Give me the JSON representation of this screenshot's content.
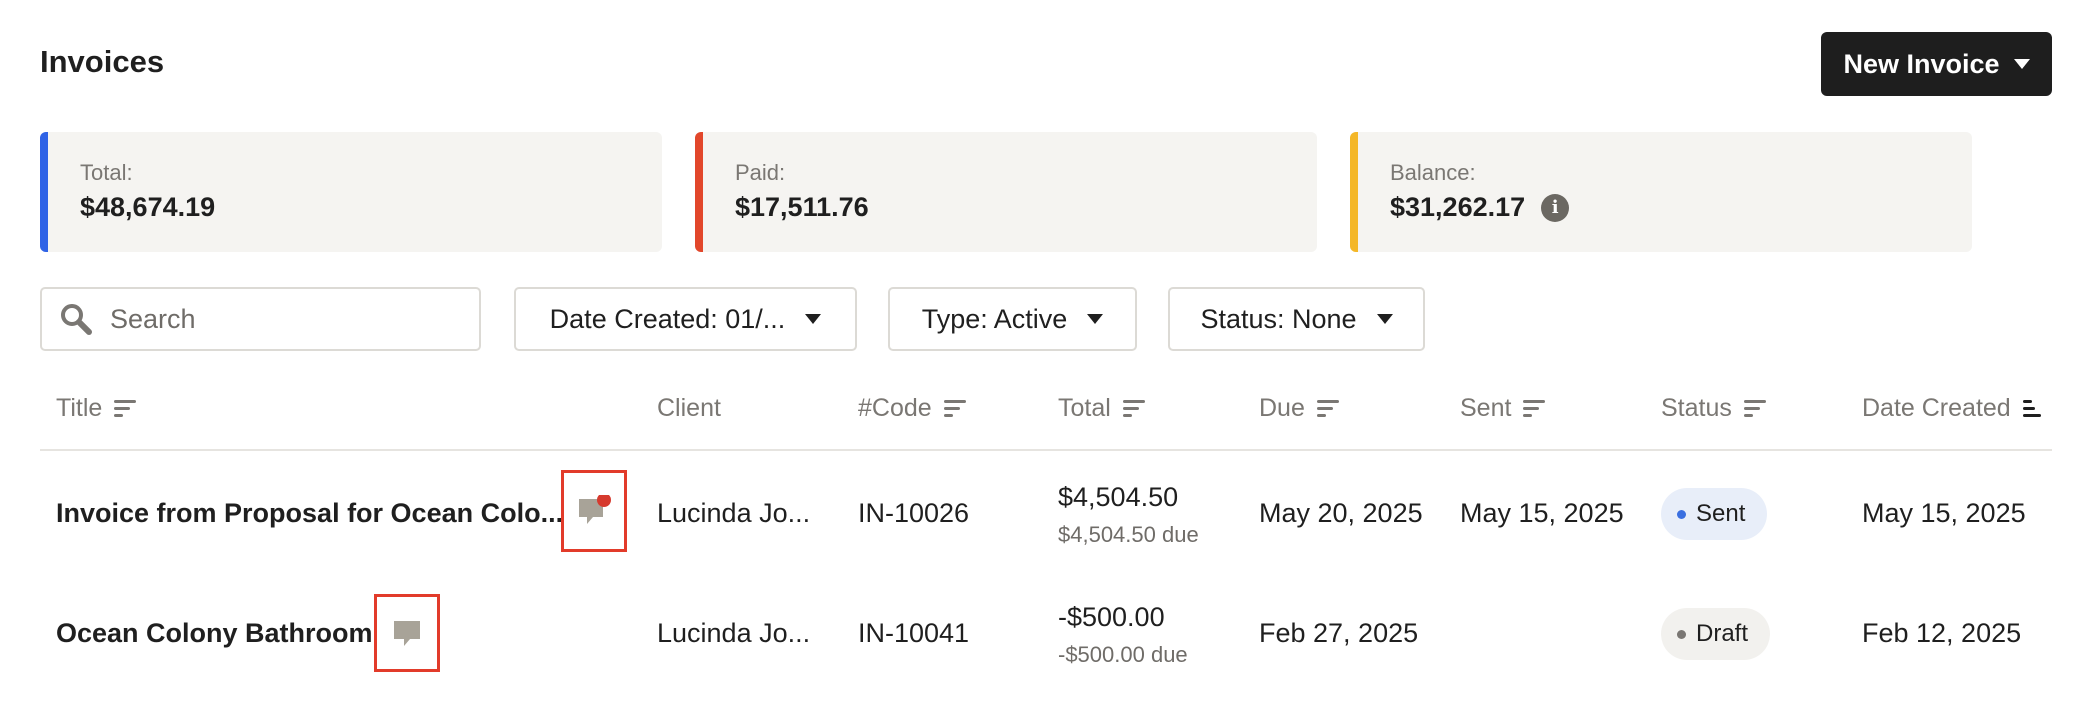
{
  "page": {
    "title": "Invoices"
  },
  "new_invoice": {
    "label": "New Invoice"
  },
  "stats": [
    {
      "label": "Total:",
      "value": "$48,674.19",
      "color": "#2f63e6"
    },
    {
      "label": "Paid:",
      "value": "$17,511.76",
      "color": "#e2472b"
    },
    {
      "label": "Balance:",
      "value": "$31,262.17",
      "color": "#f4b728"
    }
  ],
  "search": {
    "placeholder": "Search",
    "value": ""
  },
  "filters": [
    {
      "label": "Date Created: 01/..."
    },
    {
      "label": "Type: Active"
    },
    {
      "label": "Status: None"
    }
  ],
  "table": {
    "columns": [
      "Title",
      "Client",
      "#Code",
      "Total",
      "Due",
      "Sent",
      "Status",
      "Date Created"
    ],
    "rows": [
      {
        "title": "Invoice from Proposal for Ocean Colo...",
        "client": "Lucinda Jo...",
        "code": "IN-10026",
        "total": "$4,504.50",
        "due_amount": "$4,504.50 due",
        "due": "May 20, 2025",
        "sent": "May 15, 2025",
        "status": "Sent",
        "status_color": "#3a6fe0",
        "status_bg": "#e8eef9",
        "date_created": "May 15, 2025",
        "has_unread": true
      },
      {
        "title": "Ocean Colony Bathroom",
        "client": "Lucinda Jo...",
        "code": "IN-10041",
        "total": "-$500.00",
        "due_amount": "-$500.00 due",
        "due": "Feb 27, 2025",
        "sent": "",
        "status": "Draft",
        "status_color": "#7a7773",
        "status_bg": "#f2f1ee",
        "date_created": "Feb 12, 2025",
        "has_unread": false
      }
    ]
  },
  "icons": {
    "search": "search-icon",
    "sort": "sort-icon",
    "chat": "chat-bubble-icon",
    "info": "info-icon",
    "caret": "chevron-down-icon"
  },
  "colors": {
    "highlight": "#e23b2a",
    "unread_dot": "#d63a2e",
    "chat_icon": "#a8a398"
  }
}
